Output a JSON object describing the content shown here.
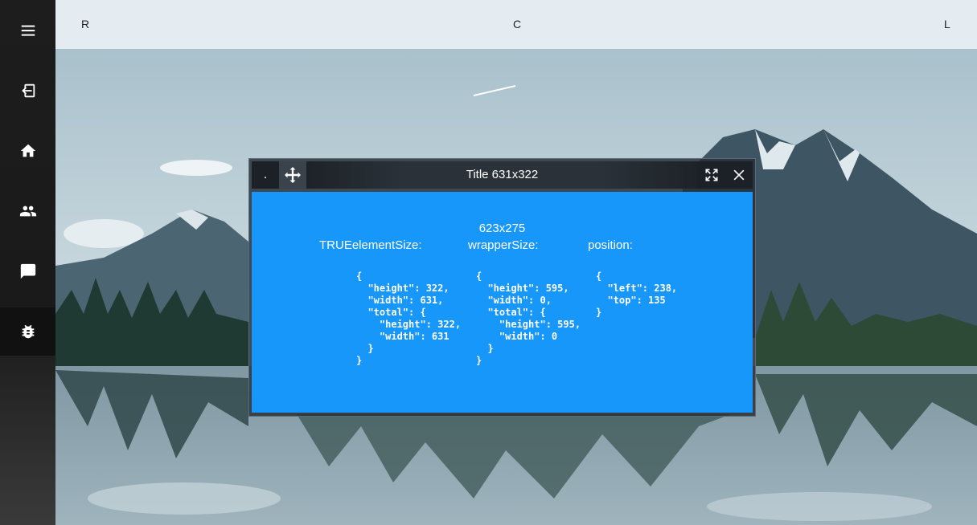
{
  "sidebar": {
    "items": [
      {
        "icon": "menu-icon"
      },
      {
        "icon": "exit-icon"
      },
      {
        "icon": "home-icon"
      },
      {
        "icon": "people-icon"
      },
      {
        "icon": "chat-icon"
      },
      {
        "icon": "bug-icon"
      }
    ]
  },
  "topbar": {
    "left": "R",
    "center": "C",
    "right": "L"
  },
  "window": {
    "title": "Title 631x322",
    "dot_label": ".",
    "content": {
      "size_label": "623x275",
      "col1_label": "TRUEelementSize:",
      "col2_label": "wrapperSize:",
      "col3_label": "position:",
      "col1_json": "{\n  \"height\": 322,\n  \"width\": 631,\n  \"total\": {\n    \"height\": 322,\n    \"width\": 631\n  }\n}",
      "col2_json": "{\n  \"height\": 595,\n  \"width\": 0,\n  \"total\": {\n    \"height\": 595,\n    \"width\": 0\n  }\n}",
      "col3_json": "{\n  \"left\": 238,\n  \"top\": 135\n}"
    }
  },
  "colors": {
    "sidebar": "#1d1d1d",
    "content_bg": "#1897fb",
    "titlebar": "#2a3138"
  }
}
